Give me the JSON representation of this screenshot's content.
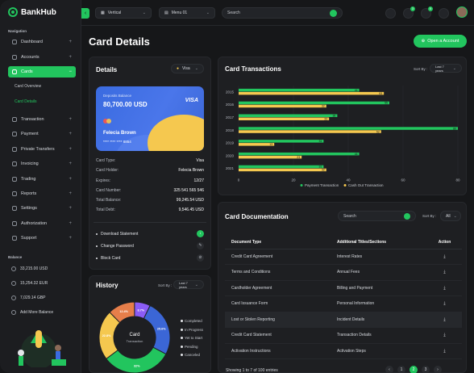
{
  "brand": {
    "name": "BankHub"
  },
  "sidebar": {
    "nav_title": "Navigation",
    "items": [
      {
        "label": "Dashboard",
        "icon": "grid-icon"
      },
      {
        "label": "Accounts",
        "icon": "user-icon"
      },
      {
        "label": "Cards",
        "icon": "card-icon",
        "active": true
      },
      {
        "label": "Transaction",
        "icon": "swap-icon"
      },
      {
        "label": "Payment",
        "icon": "wallet-icon"
      },
      {
        "label": "Private Transfers",
        "icon": "transfer-icon"
      },
      {
        "label": "Invoicing",
        "icon": "invoice-icon"
      },
      {
        "label": "Trading",
        "icon": "trading-icon"
      },
      {
        "label": "Reports",
        "icon": "report-icon"
      },
      {
        "label": "Settings",
        "icon": "gear-icon"
      },
      {
        "label": "Authorization",
        "icon": "lock-icon"
      },
      {
        "label": "Support",
        "icon": "support-icon"
      }
    ],
    "subitems": [
      "Card Overview",
      "Card Details"
    ],
    "balance_title": "Balance",
    "balances": [
      "33,215.00 USD",
      "15,254.32 EUR",
      "7,029.14 GBP",
      "Add More Balance"
    ]
  },
  "topbar": {
    "layout_select": "Vertical",
    "menu_select": "Menu 01",
    "search_placeholder": "Search",
    "badges": [
      "3",
      "5"
    ]
  },
  "page": {
    "title": "Card Details",
    "open_account": "Open a Account"
  },
  "details": {
    "title": "Details",
    "card_select": "Visa",
    "card": {
      "label": "Deposits Balance",
      "balance": "80,700.00 USD",
      "brand": "VISA",
      "holder": "Felecia Brown",
      "number": "**** **** **** 8854"
    },
    "rows": [
      {
        "k": "Card Type:",
        "v": "Visa"
      },
      {
        "k": "Card Holder:",
        "v": "Felecia Brown"
      },
      {
        "k": "Expires:",
        "v": "12/27"
      },
      {
        "k": "Card Number:",
        "v": "325 541 565 546"
      },
      {
        "k": "Total Balance:",
        "v": "99,245.54 USD"
      },
      {
        "k": "Total Debt:",
        "v": "9,546.45 USD"
      }
    ],
    "actions": [
      "Download Statement",
      "Change Password",
      "Block Card"
    ]
  },
  "history": {
    "title": "History",
    "sort_label": "Sort By :",
    "sort_value": "Last 7 years",
    "center_title": "Card",
    "center_sub": "Transaction",
    "legend": [
      "Completed",
      "In Progress",
      "Yet to Start",
      "Pending",
      "Canceled"
    ]
  },
  "transactions": {
    "title": "Card Transactions",
    "sort_label": "Sort By :",
    "sort_value": "Last 7 years"
  },
  "documentation": {
    "title": "Card Documentation",
    "search_placeholder": "Search",
    "sort_label": "Sort By :",
    "sort_value": "All",
    "headers": [
      "Document Type",
      "Additional Titles/Sections",
      "Action"
    ],
    "rows": [
      [
        "Credit Card Agreement",
        "Interest Rates"
      ],
      [
        "Terms and Conditions",
        "Annual Fees"
      ],
      [
        "Cardholder Agreement",
        "Billing and Payment"
      ],
      [
        "Card Issuance Form",
        "Personal Information"
      ],
      [
        "Lost or Stolen Reporting",
        "Incident Details"
      ],
      [
        "Credit Card Statement",
        "Transaction Details"
      ],
      [
        "Activation Instructions",
        "Activation Steps"
      ]
    ],
    "footer": "Showing 1 to 7 of 100 entries",
    "pages": [
      "1",
      "2",
      "3"
    ]
  },
  "colors": {
    "accent": "#22c55e",
    "secondary": "#f5c84f"
  },
  "chart_data": [
    {
      "type": "bar",
      "title": "Card Transactions",
      "categories": [
        "2015",
        "2016",
        "2017",
        "2018",
        "2019",
        "2020",
        "2021"
      ],
      "series": [
        {
          "name": "Payment Transaction",
          "values": [
            44,
            55,
            36,
            80,
            31,
            44,
            31
          ]
        },
        {
          "name": "Cash Out Transaction",
          "values": [
            53,
            32,
            33,
            52,
            13,
            23,
            32
          ]
        }
      ],
      "xlim": [
        0,
        80
      ],
      "xticks": [
        "0",
        "20",
        "40",
        "60",
        "80"
      ],
      "legend": "bottom"
    },
    {
      "type": "pie",
      "title": "History",
      "labels": [
        "Completed",
        "In Progress",
        "Yet to Start",
        "Pending",
        "Canceled"
      ],
      "values": [
        25.6,
        32,
        22.8,
        12.4,
        7.2
      ],
      "display": [
        "25.6%",
        "32%",
        "22.8%",
        "12.4%",
        "8.7%"
      ]
    }
  ]
}
